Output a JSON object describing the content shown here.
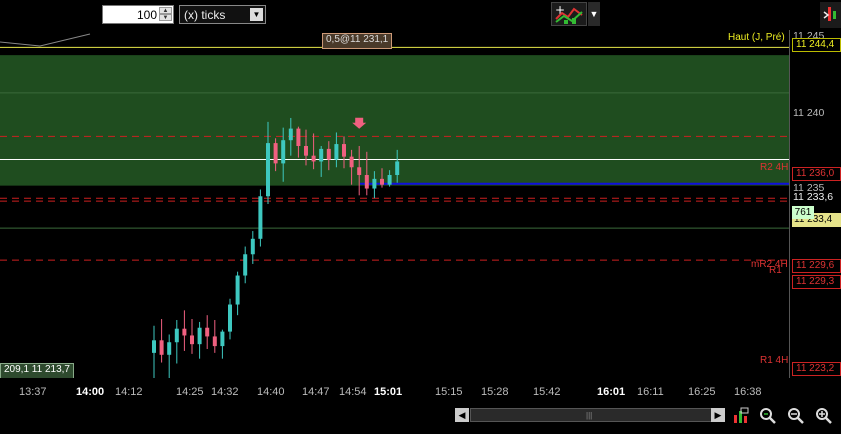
{
  "toolbar": {
    "quantity": "100",
    "unit": "(x) ticks",
    "chart_tool_icon": "chart-objects-icon",
    "right_tool_icon": "cursor-tool-icon"
  },
  "tags": {
    "top_order": "0,5@11 231,1",
    "bottom_left": "209,1 11 213,7",
    "haut_label": "Haut (J, Pré)"
  },
  "price_axis": {
    "labels": [
      "11 245",
      "11 240",
      "11 235"
    ],
    "red_tags": [
      "11 236,0",
      "11 229,6",
      "11 229,3",
      "11 223,2"
    ],
    "yellow_tag": "11 244,4",
    "last_tag": "11 233,4",
    "plain_tag": "11 233,6",
    "volume_tag": "761"
  },
  "levels": {
    "r2": "R2 4H",
    "mr2": "mR2 4H",
    "r1b": "R1",
    "r1": "R1 4H"
  },
  "time_axis": [
    {
      "label": "13:37",
      "bold": false
    },
    {
      "label": "14:00",
      "bold": true
    },
    {
      "label": "14:12",
      "bold": false
    },
    {
      "label": "14:25",
      "bold": false
    },
    {
      "label": "14:32",
      "bold": false
    },
    {
      "label": "14:40",
      "bold": false
    },
    {
      "label": "14:47",
      "bold": false
    },
    {
      "label": "14:54",
      "bold": false
    },
    {
      "label": "15:01",
      "bold": true
    },
    {
      "label": "15:15",
      "bold": false
    },
    {
      "label": "15:28",
      "bold": false
    },
    {
      "label": "15:42",
      "bold": false
    },
    {
      "label": "16:01",
      "bold": true
    },
    {
      "label": "16:11",
      "bold": false
    },
    {
      "label": "16:25",
      "bold": false
    },
    {
      "label": "16:38",
      "bold": false
    }
  ],
  "bottom_icons": [
    "bar-settings-icon",
    "zoom-fit-icon",
    "zoom-out-icon",
    "zoom-in-icon"
  ],
  "colors": {
    "zone": "#1f4d1f",
    "up": "#3ec8c0",
    "down": "#f06080",
    "blue_line": "#1010dd",
    "red_level": "#cc2020"
  },
  "chart_data": {
    "type": "candlestick",
    "y_unit": "price",
    "ylim": [
      11211,
      11247
    ],
    "candles": [
      {
        "o": 11213.6,
        "h": 11216.4,
        "l": 11211.0,
        "c": 11214.9
      },
      {
        "o": 11214.9,
        "h": 11217.1,
        "l": 11212.6,
        "c": 11213.4
      },
      {
        "o": 11213.4,
        "h": 11215.5,
        "l": 11211.0,
        "c": 11214.7
      },
      {
        "o": 11214.7,
        "h": 11217.0,
        "l": 11212.5,
        "c": 11216.1
      },
      {
        "o": 11216.1,
        "h": 11218.0,
        "l": 11213.8,
        "c": 11215.4
      },
      {
        "o": 11215.4,
        "h": 11217.1,
        "l": 11213.5,
        "c": 11214.5
      },
      {
        "o": 11214.5,
        "h": 11216.8,
        "l": 11213.0,
        "c": 11216.2
      },
      {
        "o": 11216.2,
        "h": 11217.5,
        "l": 11214.0,
        "c": 11215.3
      },
      {
        "o": 11215.3,
        "h": 11217.0,
        "l": 11213.6,
        "c": 11214.3
      },
      {
        "o": 11214.3,
        "h": 11216.0,
        "l": 11213.0,
        "c": 11215.8
      },
      {
        "o": 11215.8,
        "h": 11219.2,
        "l": 11215.0,
        "c": 11218.6
      },
      {
        "o": 11218.6,
        "h": 11222.0,
        "l": 11217.5,
        "c": 11221.6
      },
      {
        "o": 11221.6,
        "h": 11224.6,
        "l": 11220.8,
        "c": 11223.8
      },
      {
        "o": 11223.8,
        "h": 11226.2,
        "l": 11222.8,
        "c": 11225.4
      },
      {
        "o": 11225.4,
        "h": 11230.5,
        "l": 11224.6,
        "c": 11229.8
      },
      {
        "o": 11229.8,
        "h": 11237.5,
        "l": 11229.0,
        "c": 11235.3
      },
      {
        "o": 11235.3,
        "h": 11235.8,
        "l": 11232.4,
        "c": 11233.2
      },
      {
        "o": 11233.2,
        "h": 11236.9,
        "l": 11231.3,
        "c": 11235.6
      },
      {
        "o": 11235.6,
        "h": 11237.9,
        "l": 11234.0,
        "c": 11236.8
      },
      {
        "o": 11236.8,
        "h": 11237.0,
        "l": 11233.8,
        "c": 11235.0
      },
      {
        "o": 11235.0,
        "h": 11236.7,
        "l": 11233.0,
        "c": 11234.0
      },
      {
        "o": 11234.0,
        "h": 11236.3,
        "l": 11232.6,
        "c": 11233.4
      },
      {
        "o": 11233.4,
        "h": 11235.0,
        "l": 11231.8,
        "c": 11234.7
      },
      {
        "o": 11234.7,
        "h": 11235.5,
        "l": 11232.5,
        "c": 11233.6
      },
      {
        "o": 11233.6,
        "h": 11236.4,
        "l": 11232.8,
        "c": 11235.2
      },
      {
        "o": 11235.2,
        "h": 11236.0,
        "l": 11232.7,
        "c": 11233.9
      },
      {
        "o": 11233.9,
        "h": 11234.6,
        "l": 11231.0,
        "c": 11232.8
      },
      {
        "o": 11232.8,
        "h": 11235.0,
        "l": 11229.9,
        "c": 11232.0
      },
      {
        "o": 11232.0,
        "h": 11234.4,
        "l": 11229.9,
        "c": 11230.6
      },
      {
        "o": 11230.6,
        "h": 11232.4,
        "l": 11229.6,
        "c": 11231.6
      },
      {
        "o": 11231.6,
        "h": 11232.7,
        "l": 11230.7,
        "c": 11231.0
      },
      {
        "o": 11231.0,
        "h": 11232.5,
        "l": 11230.8,
        "c": 11232.0
      },
      {
        "o": 11232.0,
        "h": 11234.6,
        "l": 11231.2,
        "c": 11233.4
      }
    ],
    "zone": {
      "top": 11244.4,
      "bottom": 11230.9
    },
    "lines": [
      {
        "y": 11245.2,
        "kind": "yellow"
      },
      {
        "y": 11236.0,
        "kind": "red"
      },
      {
        "y": 11233.6,
        "kind": "white"
      },
      {
        "y": 11231.1,
        "kind": "blue"
      },
      {
        "y": 11229.6,
        "kind": "red"
      },
      {
        "y": 11229.3,
        "kind": "red"
      },
      {
        "y": 11223.2,
        "kind": "red"
      }
    ]
  }
}
